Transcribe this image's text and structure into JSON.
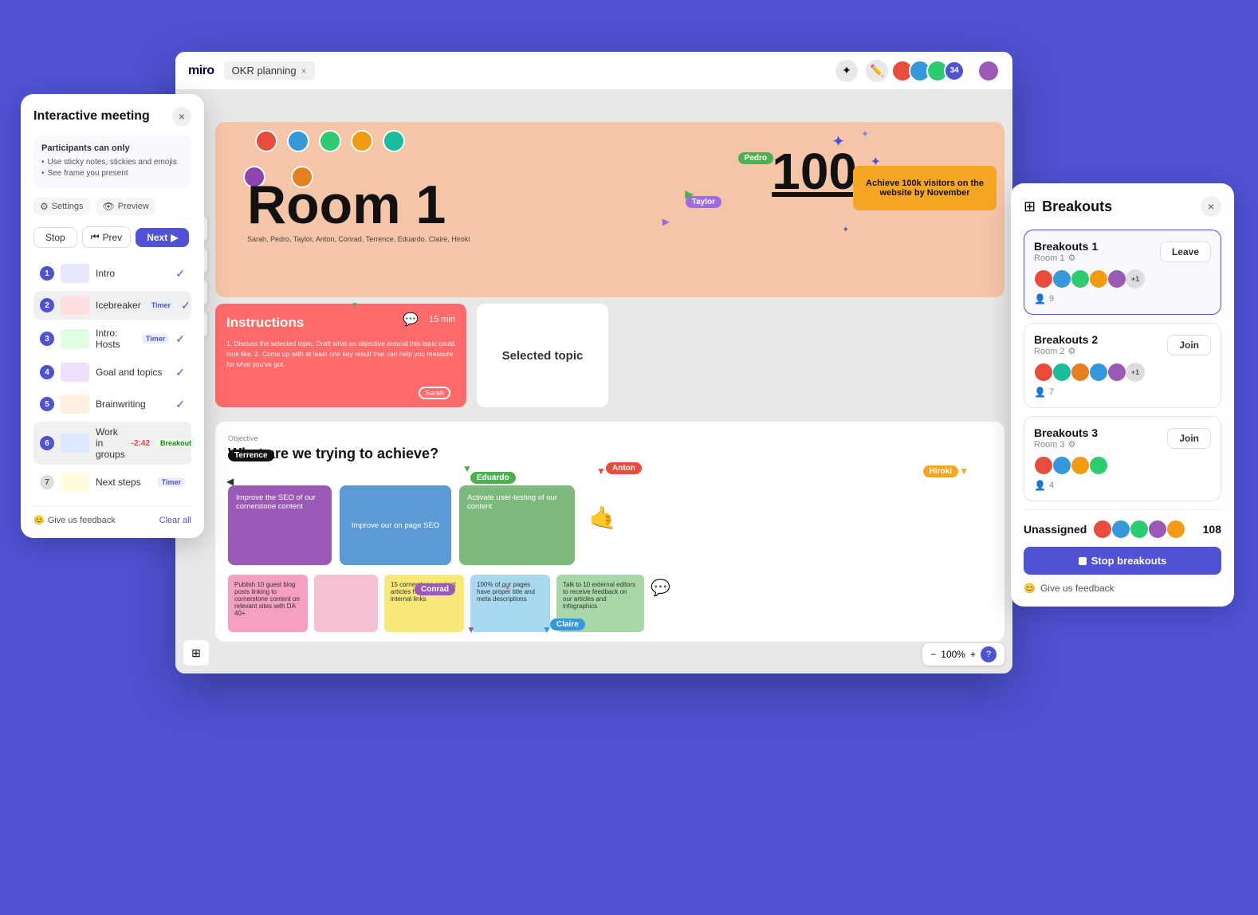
{
  "app": {
    "name": "miro",
    "board_name": "OKR planning",
    "room_label": "Room 1"
  },
  "topbar": {
    "logo": "miro",
    "board_tab": "OKR planning",
    "participant_count": "34",
    "zoom_level": "100%",
    "zoom_minus": "−",
    "zoom_plus": "+",
    "zoom_help": "?"
  },
  "meeting_panel": {
    "title": "Interactive meeting",
    "close_label": "×",
    "participants_note_title": "Participants can only",
    "note_items": [
      "Use sticky notes, stickies and emojis",
      "See frame you present"
    ],
    "settings_label": "Settings",
    "preview_label": "Preview",
    "stop_label": "Stop",
    "prev_label": "Prev",
    "next_label": "Next",
    "steps": [
      {
        "number": "1",
        "name": "Intro",
        "done": true
      },
      {
        "number": "2",
        "name": "Icebreaker",
        "tag": "Timer",
        "tag_type": "timer",
        "done": true
      },
      {
        "number": "3",
        "name": "Intro: Hosts",
        "tag": "Timer",
        "tag_type": "timer",
        "done": true
      },
      {
        "number": "4",
        "name": "Goal and topics",
        "done": true
      },
      {
        "number": "5",
        "name": "Brainwriting",
        "done": true
      },
      {
        "number": "6",
        "name": "Work in groups",
        "tag": "Breakout",
        "tag_type": "breakout",
        "time": "-2:42",
        "done": false
      },
      {
        "number": "7",
        "name": "Next steps",
        "tag": "Timer",
        "tag_type": "timer",
        "done": false
      }
    ],
    "feedback_label": "Give us feedback",
    "clear_label": "Clear all"
  },
  "breakouts_panel": {
    "title": "Breakouts",
    "close_label": "×",
    "rooms": [
      {
        "name": "Breakouts 1",
        "sub": "Room 1",
        "active": true,
        "action": "Leave",
        "count": 9
      },
      {
        "name": "Breakouts 2",
        "sub": "Room 2",
        "active": false,
        "action": "Join",
        "count": 7
      },
      {
        "name": "Breakouts 3",
        "sub": "Room 3",
        "active": false,
        "action": "Join",
        "count": 4
      }
    ],
    "unassigned_label": "Unassigned",
    "unassigned_count": "108",
    "stop_breakouts_label": "Stop breakouts",
    "feedback_label": "Give us feedback"
  },
  "canvas": {
    "room1_title": "Room 1",
    "room1_subtitle": "Sarah, Pedro, Taylor, Anton, Conrad, Terrence,\nEduardo, Claire, Hiroki",
    "badge_100": "100",
    "achieve_text": "Achieve 100k visitors on the website by November",
    "instructions_title": "Instructions",
    "instructions_time": "15 min",
    "instructions_text": "1. Discuss the selected topic. Draft what an objective around this topic could look like.\n2. Come up with at least one key result that can help you measure for what you've got.",
    "selected_topic": "Selected topic",
    "pedro_label": "Pedro",
    "taylor_label": "Taylor",
    "okr_objective": "Objective",
    "okr_title": "What are we trying to achieve?",
    "sticky1": "Improve the SEO of our cornerstone content",
    "sticky2": "Improve our on page SEO",
    "sticky3": "Activate user-testing of our content",
    "sticky4": "Publish 10 guest blog posts linking to cornerstone content on relevant sites with DA 40+",
    "sticky5": "15 cornerstone content articles has at least 10 internal links",
    "sticky6": "100% of our pages have proper title and meta descriptions",
    "sticky7": "Talk to 10 external editors to receive feedback on our articles and infographics",
    "terrence_label": "Terrence",
    "eduardo_label": "Eduardo",
    "anton_label": "Anton",
    "hiroki_label": "Hiroki",
    "claire_label": "Claire",
    "sarah_label": "Sarah",
    "conrad_label": "Conrad"
  }
}
